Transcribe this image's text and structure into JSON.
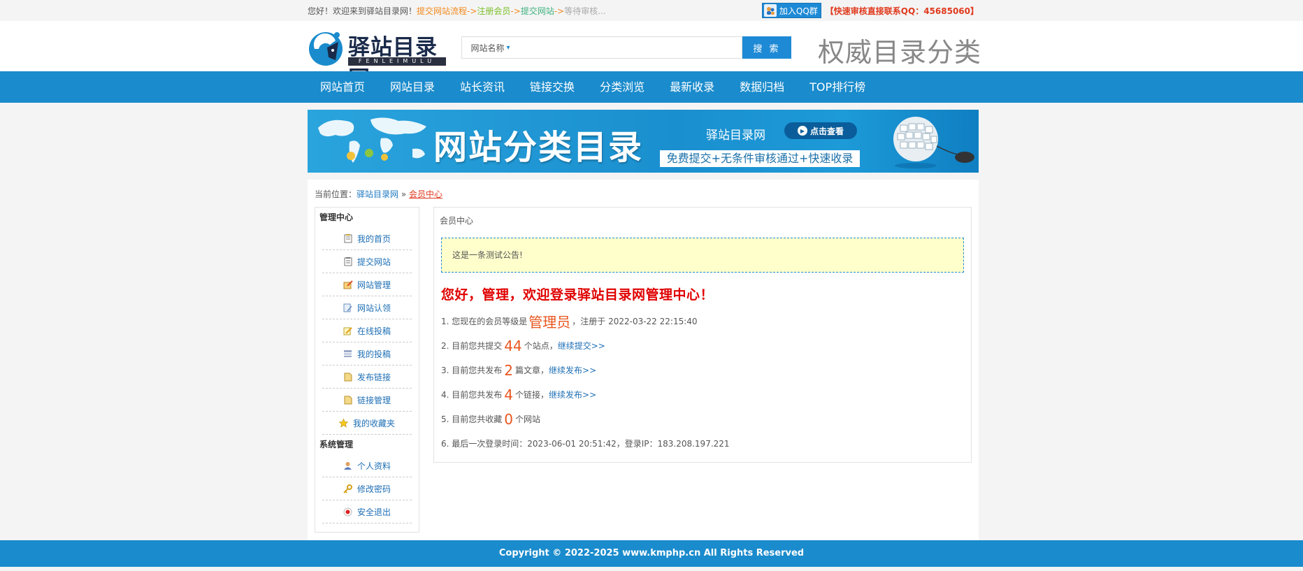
{
  "topbar": {
    "greeting": "您好！欢迎来到驿站目录网！",
    "step1": "提交网站流程",
    "arrow": "->",
    "step2": "注册会员",
    "step3": "提交网站",
    "step4": "等待审核...",
    "qq_group": "加入QQ群",
    "qq_contact": "【快速审核直接联系QQ：45685060】"
  },
  "header": {
    "logo_text": "驿站目录网",
    "logo_sub": "FENLEIMULU",
    "search_select": "网站名称",
    "search_placeholder": "",
    "search_button": "搜 索",
    "slogan": "权威目录分类"
  },
  "nav": {
    "items": [
      {
        "label": "网站首页"
      },
      {
        "label": "网站目录"
      },
      {
        "label": "站长资讯"
      },
      {
        "label": "链接交换"
      },
      {
        "label": "分类浏览"
      },
      {
        "label": "最新收录"
      },
      {
        "label": "数据归档"
      },
      {
        "label": "TOP排行榜"
      }
    ]
  },
  "banner": {
    "title": "网站分类目录",
    "site": "驿站目录网",
    "button": "点击查看",
    "strip": "免费提交+无条件审核通过+快速收录"
  },
  "breadcrumb": {
    "prefix": "当前位置：",
    "home": "驿站目录网",
    "sep": "»",
    "current": "会员中心"
  },
  "sidebar": {
    "group1_title": "管理中心",
    "group1": [
      {
        "label": "我的首页",
        "icon": "notepad-icon"
      },
      {
        "label": "提交网站",
        "icon": "clipboard-icon"
      },
      {
        "label": "网站管理",
        "icon": "site-manage-icon"
      },
      {
        "label": "网站认领",
        "icon": "claim-icon"
      },
      {
        "label": "在线投稿",
        "icon": "pencil-icon"
      },
      {
        "label": "我的投稿",
        "icon": "list-icon"
      },
      {
        "label": "发布链接",
        "icon": "doc-icon"
      },
      {
        "label": "链接管理",
        "icon": "doc-icon"
      },
      {
        "label": "我的收藏夹",
        "icon": "star-icon"
      }
    ],
    "group2_title": "系统管理",
    "group2": [
      {
        "label": "个人资料",
        "icon": "user-icon"
      },
      {
        "label": "修改密码",
        "icon": "key-icon"
      },
      {
        "label": "安全退出",
        "icon": "logout-icon"
      }
    ]
  },
  "content": {
    "title": "会员中心",
    "notice": "这是一条测试公告!",
    "welcome": "您好，管理，欢迎登录驿站目录网管理中心！",
    "stat1_pre": "1. 您现在的会员等级是",
    "stat1_level": "管理员",
    "stat1_post": "，注册于 2022-03-22 22:15:40",
    "stat2_pre": "2. 目前您共提交",
    "stat2_num": "44",
    "stat2_post": "个站点，",
    "stat2_link": "继续提交>>",
    "stat3_pre": "3. 目前您共发布",
    "stat3_num": "2",
    "stat3_post": "篇文章，",
    "stat3_link": "继续发布>>",
    "stat4_pre": "4. 目前您共发布",
    "stat4_num": "4",
    "stat4_post": "个链接，",
    "stat4_link": "继续发布>>",
    "stat5_pre": "5. 目前您共收藏",
    "stat5_num": "0",
    "stat5_post": "个网站",
    "stat6": "6. 最后一次登录时间：2023-06-01 20:51:42，登录IP：183.208.197.221"
  },
  "footer": {
    "copyright": "Copyright © 2022-2025 www.kmphp.cn All Rights Reserved"
  },
  "colors": {
    "accent": "#1a8bcc",
    "warning": "#e03a1e",
    "notice_bg": "#ffffcc"
  }
}
